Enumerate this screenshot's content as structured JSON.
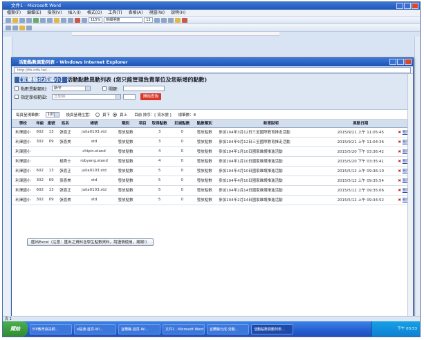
{
  "word": {
    "title": "文件1 - Microsoft Word",
    "menu": [
      "檔案(F)",
      "編輯(E)",
      "檢視(V)",
      "插入(I)",
      "格式(O)",
      "工具(T)",
      "表格(A)",
      "視窗(W)",
      "說明(H)"
    ],
    "zoom": "115%",
    "font": "新細明體",
    "font_size": "12",
    "status_left": "頁 1"
  },
  "ie": {
    "title": "活動點數異動列表 - Windows Internet Explorer",
    "address": "http://tfs.ntfu.tw/..."
  },
  "page": {
    "title_highlight": "【宜蘭縣北成國小】",
    "title_rest": "活動點數異動列表 (您只能管理負責單位及您新增的點數)",
    "filter_type_label": "點數異動類別：",
    "filter_type_value": "新令",
    "filter_keyword_label": "關鍵：",
    "filter_school_label": "指定學校範圍：",
    "filter_school_value": "宜蘭縣",
    "search_button": "開始查詢",
    "page_size_label": "每頁呈現筆數：",
    "page_size_value": "100",
    "position_label": "換頁呈現位置：",
    "position_options": [
      "頁下",
      "頁上"
    ],
    "order_label": "目前 排序：[ 流水號 ]",
    "total_label": "總筆數：8",
    "export_button": "匯出Excel（注意：匯出之資料含學生點數資料，請謹慎使用，謝謝!）"
  },
  "table": {
    "headers": [
      "學校",
      "年級",
      "座號",
      "姓名",
      "帳號",
      "類別",
      "項目",
      "取得點數",
      "扣減點數",
      "點數類別",
      "新增說明",
      "異動日期",
      ""
    ],
    "rows": [
      [
        "利澤國小",
        "602",
        "13",
        "張喜正",
        "julia0103.std",
        "發放點數",
        "",
        "3",
        "0",
        "發放點數",
        "參加104年3月12日三至國際教育推走活動",
        "2015/9/21 上午 11:05:45",
        "刪除"
      ],
      [
        "利澤國小",
        "302",
        "09",
        "張喜美",
        "std",
        "發放點數",
        "",
        "3",
        "0",
        "發放點數",
        "參加104年9月12日三至國際教育推走活動",
        "2015/9/21 上午 11:04:36",
        "刪除"
      ],
      [
        "利澤國小",
        "",
        "",
        "",
        "chipin.eland",
        "發放點數",
        "",
        "4",
        "0",
        "發放點數",
        "參加104年1月10日國家維護推進活動",
        "2015/5/20 下午 03:36:42",
        "刪除"
      ],
      [
        "利澤國小",
        "",
        "",
        "楊秀士",
        "robyang.eland",
        "發放點數",
        "",
        "4",
        "0",
        "發放點數",
        "參加104年1月10日國家維護推進活動",
        "2015/5/20 下午 03:35:41",
        "刪除"
      ],
      [
        "利澤國小",
        "602",
        "13",
        "張喜正",
        "julia0103.std",
        "發放點數",
        "",
        "5",
        "0",
        "發放點數",
        "參加104年4月10日國家維護推進活動",
        "2015/5/12 上午 09:36:10",
        "刪除"
      ],
      [
        "利澤國小",
        "302",
        "09",
        "張喜美",
        "std",
        "發放點數",
        "",
        "5",
        "0",
        "發放點數",
        "參加104年4月10日國家維護推進活動",
        "2015/5/12 上午 09:35:54",
        "刪除"
      ],
      [
        "利澤國小",
        "602",
        "13",
        "張喜正",
        "julia0103.std",
        "發放點數",
        "",
        "5",
        "0",
        "發放點數",
        "參加104年2月14日國家維護推進活動",
        "2015/5/12 上午 09:35:06",
        "刪除"
      ],
      [
        "利澤國小",
        "302",
        "09",
        "張喜美",
        "std",
        "發放點數",
        "",
        "5",
        "0",
        "發放點數",
        "參加104年2月14日國家維護推進活動",
        "2015/5/12 上午 09:34:52",
        "刪除"
      ]
    ]
  },
  "taskbar": {
    "start": "開始",
    "tasks": [
      "EIP教育資訊網...",
      "e點通-首頁-Wi...",
      "宜蘭縣-首頁-Wi...",
      "文件1 - Microsoft Word",
      "宜蘭縣北成-活動...",
      "活動點數異動列表..."
    ],
    "clock": "下午 03:53"
  },
  "colors": {
    "accent": "#3660a8",
    "search_button": "#d8372a",
    "delete": "#c02020"
  }
}
